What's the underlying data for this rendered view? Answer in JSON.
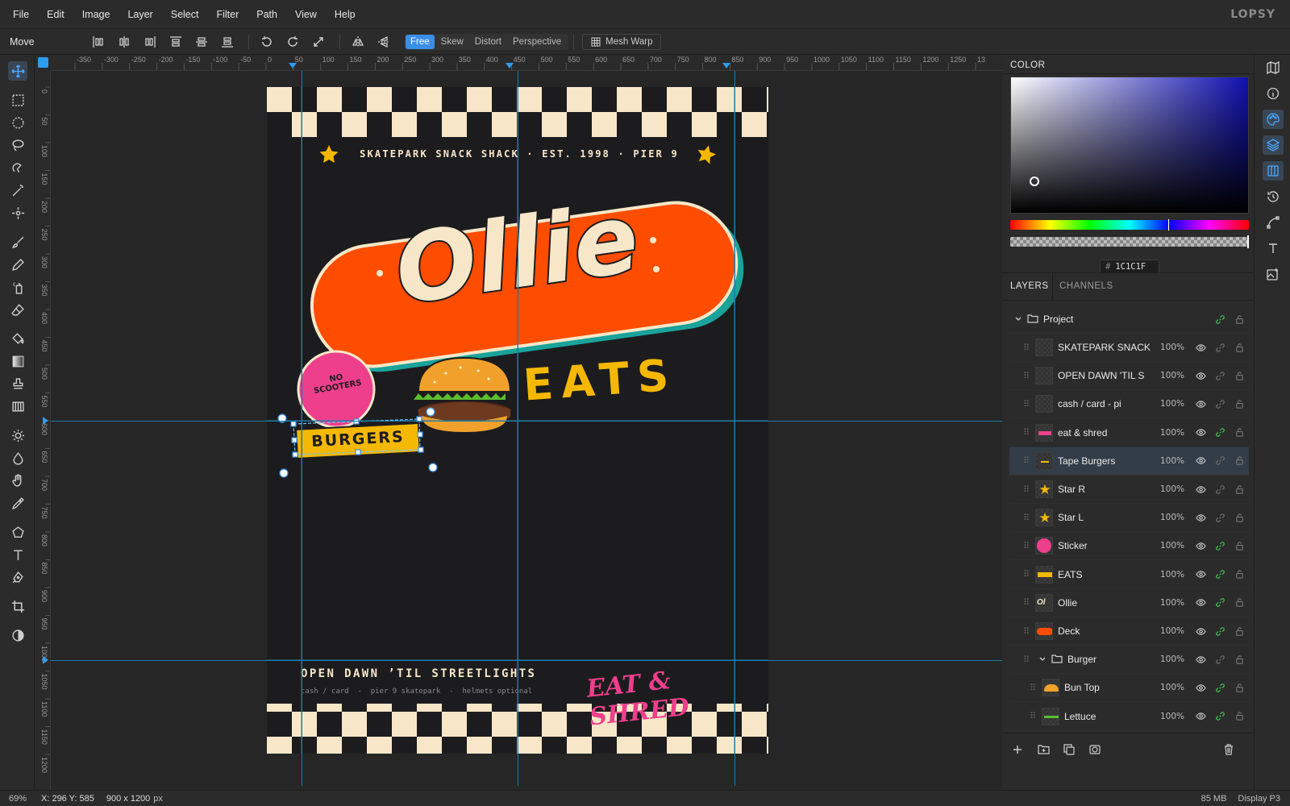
{
  "menu": [
    "File",
    "Edit",
    "Image",
    "Layer",
    "Select",
    "Filter",
    "Path",
    "View",
    "Help"
  ],
  "brand": "LOPSY",
  "options": {
    "tool_name": "Move",
    "modes": [
      "Free",
      "Skew",
      "Distort",
      "Perspective"
    ],
    "active_mode": "Free",
    "mesh_warp": "Mesh Warp"
  },
  "ruler": {
    "top": [
      "-350",
      "-300",
      "-250",
      "-200",
      "-150",
      "-100",
      "-50",
      "0",
      "50",
      "100",
      "150",
      "200",
      "250",
      "300",
      "350",
      "400",
      "450",
      "500",
      "550",
      "600",
      "650",
      "700",
      "750",
      "800",
      "850",
      "900",
      "950",
      "1000",
      "1050",
      "1100",
      "1150",
      "1200",
      "1250",
      "13"
    ],
    "left": [
      "0",
      "50",
      "100",
      "150",
      "200",
      "250",
      "300",
      "350",
      "400",
      "450",
      "500",
      "550",
      "600",
      "650",
      "700",
      "750",
      "800",
      "850",
      "900",
      "950",
      "1000",
      "1050",
      "1100",
      "1150",
      "1200"
    ]
  },
  "poster": {
    "header": "SKATEPARK SNACK SHACK · EST. 1998 · PIER 9",
    "ollie": "Ollie",
    "eats": "EATS",
    "sticker_line1": "NO",
    "sticker_line2": "SCOOTERS",
    "burgers": "BURGERS",
    "open": "OPEN DAWN ’TIL STREETLIGHTS",
    "info": "cash / card  -  pier 9 skatepark  -  helmets optional",
    "slogan": "EAT & SHRED",
    "colors": {
      "orange": "#ff4d00",
      "cream": "#f7e7c8",
      "teal": "#1aa39b",
      "yellow": "#f5b800",
      "pink": "#ee3f8c",
      "dark": "#1c1c1f"
    }
  },
  "color_panel": {
    "title": "COLOR",
    "hex": "1C1C1F",
    "hash": "#"
  },
  "layers_panel": {
    "tabs": [
      "LAYERS",
      "CHANNELS"
    ],
    "project": "Project",
    "layers": [
      {
        "name": "SKATEPARK SNACK",
        "opacity": "100%"
      },
      {
        "name": "OPEN DAWN 'TIL S",
        "opacity": "100%"
      },
      {
        "name": "cash / card - pi",
        "opacity": "100%"
      },
      {
        "name": "eat & shred",
        "opacity": "100%"
      },
      {
        "name": "Tape Burgers",
        "opacity": "100%"
      },
      {
        "name": "Star R",
        "opacity": "100%"
      },
      {
        "name": "Star L",
        "opacity": "100%"
      },
      {
        "name": "Sticker",
        "opacity": "100%"
      },
      {
        "name": "EATS",
        "opacity": "100%"
      },
      {
        "name": "Ollie",
        "opacity": "100%"
      },
      {
        "name": "Deck",
        "opacity": "100%"
      },
      {
        "name": "Burger",
        "opacity": "100%"
      },
      {
        "name": "Bun Top",
        "opacity": "100%"
      },
      {
        "name": "Lettuce",
        "opacity": "100%"
      }
    ]
  },
  "status": {
    "zoom": "69%",
    "xy": "X: 296 Y: 585",
    "dims": "900 x 1200",
    "unit": "px",
    "memory": "85 MB",
    "profile": "Display P3"
  }
}
